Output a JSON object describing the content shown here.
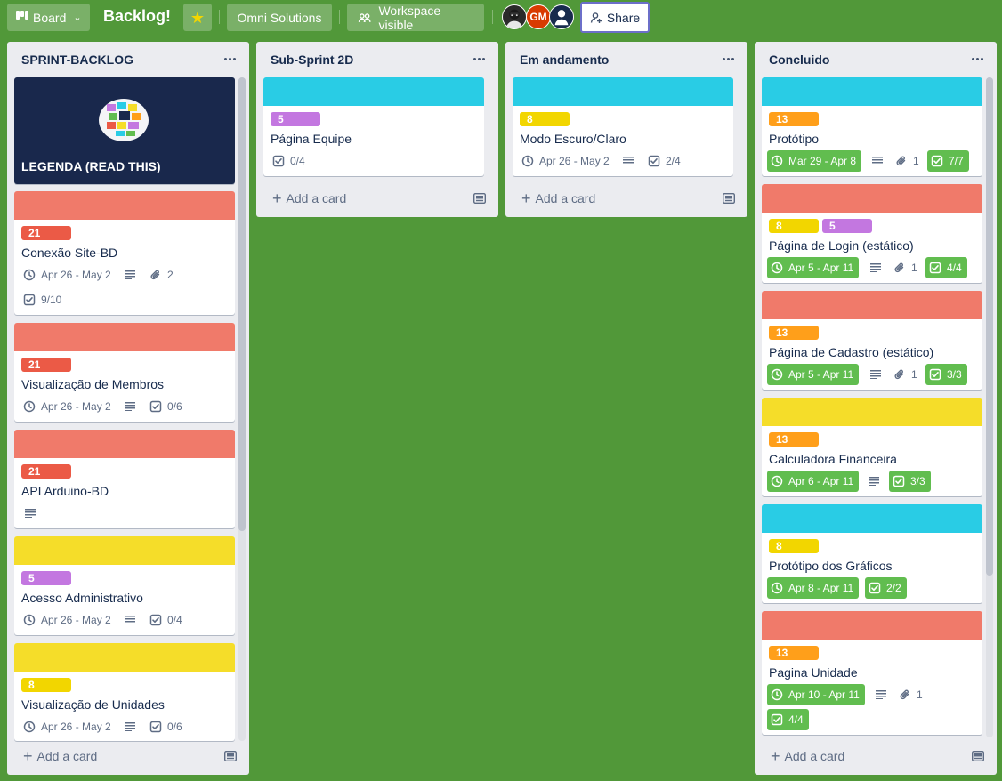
{
  "header": {
    "board_label": "Board",
    "title": "Backlog!",
    "workspace": "Omni Solutions",
    "visibility": "Workspace visible",
    "avatar2_initials": "GM",
    "share": "Share"
  },
  "colors": {
    "background": "#519839",
    "green": "#61bd4f",
    "red_cover": "#f07a6a",
    "cyan_cover": "#29cce5",
    "yellow_cover": "#f5dd29",
    "label_red": "#eb5a46",
    "label_purple": "#c377e0",
    "label_yellow": "#f2d600",
    "label_orange": "#ff9f1a"
  },
  "lists": [
    {
      "title": "SPRINT-BACKLOG",
      "add": "Add a card",
      "cards": [
        {
          "title": "LEGENDA (READ THIS)"
        },
        {
          "label": "21",
          "title": "Conexão Site-BD",
          "due": "Apr 26 - May 2",
          "attachments": "2",
          "checklist": "9/10"
        },
        {
          "label": "21",
          "title": "Visualização de Membros",
          "due": "Apr 26 - May 2",
          "checklist": "0/6"
        },
        {
          "label": "21",
          "title": "API Arduino-BD"
        },
        {
          "label": "5",
          "title": "Acesso Administrativo",
          "due": "Apr 26 - May 2",
          "checklist": "0/4"
        },
        {
          "label": "8",
          "title": "Visualização de Unidades",
          "due": "Apr 26 - May 2",
          "checklist": "0/6"
        }
      ]
    },
    {
      "title": "Sub-Sprint 2D",
      "add": "Add a card",
      "cards": [
        {
          "label": "5",
          "title": "Página Equipe",
          "checklist": "0/4"
        }
      ]
    },
    {
      "title": "Em andamento",
      "add": "Add a card",
      "cards": [
        {
          "label": "8",
          "title": "Modo Escuro/Claro",
          "due": "Apr 26 - May 2",
          "checklist": "2/4"
        }
      ]
    },
    {
      "title": "Concluido",
      "add": "Add a card",
      "cards": [
        {
          "label": "13",
          "title": "Protótipo",
          "due": "Mar 29 - Apr 8",
          "attachments": "1",
          "checklist": "7/7"
        },
        {
          "label": "8",
          "label2": "5",
          "title": "Página de Login (estático)",
          "due": "Apr 5 - Apr 11",
          "attachments": "1",
          "checklist": "4/4"
        },
        {
          "label": "13",
          "title": "Página de Cadastro (estático)",
          "due": "Apr 5 - Apr 11",
          "attachments": "1",
          "checklist": "3/3"
        },
        {
          "label": "13",
          "title": "Calculadora Financeira",
          "due": "Apr 6 - Apr 11",
          "checklist": "3/3"
        },
        {
          "label": "8",
          "title": "Protótipo dos Gráficos",
          "due": "Apr 8 - Apr 11",
          "checklist": "2/2"
        },
        {
          "label": "13",
          "title": "Pagina Unidade",
          "due": "Apr 10 - Apr 11",
          "attachments": "1",
          "checklist": "4/4"
        }
      ]
    }
  ]
}
